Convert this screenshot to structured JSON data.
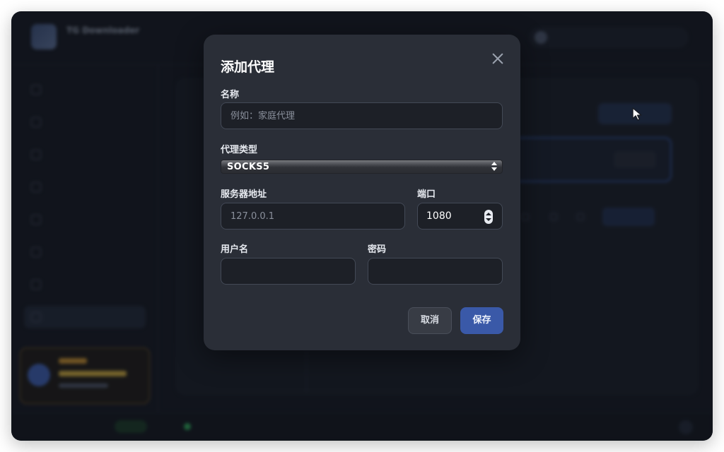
{
  "background": {
    "app_title": "TG Downloader",
    "app_subtitle": "",
    "account_email": "",
    "sidebar_items": [
      "",
      "",
      "",
      "",
      "",
      "",
      "",
      ""
    ],
    "statusbar": {
      "left": "",
      "mid": "",
      "right": ""
    }
  },
  "modal": {
    "title": "添加代理",
    "name_label": "名称",
    "name_placeholder": "例如：家庭代理",
    "type_label": "代理类型",
    "type_value": "SOCKS5",
    "server_label": "服务器地址",
    "server_placeholder": "127.0.0.1",
    "port_label": "端口",
    "port_value": "1080",
    "username_label": "用户名",
    "password_label": "密码",
    "cancel_label": "取消",
    "save_label": "保存"
  },
  "icons": {
    "close": "close-icon",
    "cursor": "mouse-pointer-icon",
    "select": "select-arrows-icon",
    "spinner": "number-stepper-icon"
  },
  "colors": {
    "modal_bg": "#2a2e37",
    "input_bg": "#1d2027",
    "primary": "#3a59a8",
    "backdrop": "#171b23"
  }
}
